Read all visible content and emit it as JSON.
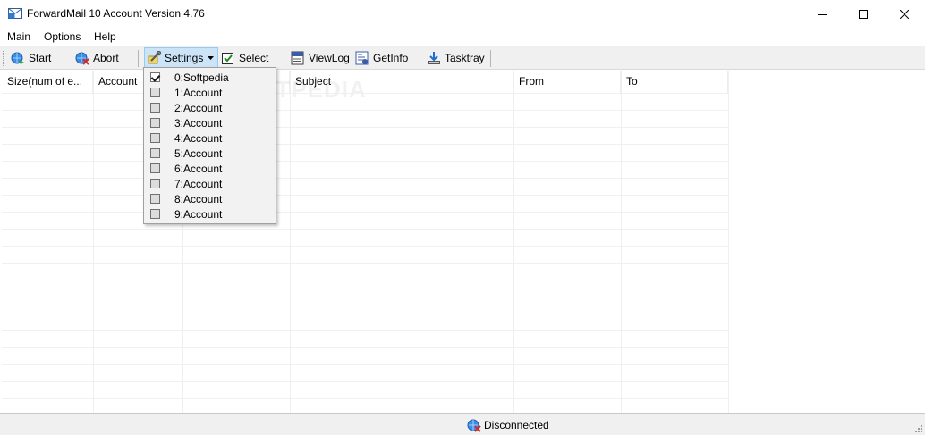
{
  "window": {
    "title": "ForwardMail 10 Account Version 4.76",
    "icon": "mail-forward-icon"
  },
  "menu": {
    "items": [
      "Main",
      "Options",
      "Help"
    ]
  },
  "toolbar": {
    "start_label": "Start",
    "abort_label": "Abort",
    "settings_label": "Settings",
    "select_label": "Select",
    "viewlog_label": "ViewLog",
    "getinfo_label": "GetInfo",
    "tasktray_label": "Tasktray"
  },
  "grid": {
    "columns": [
      "Size(num of e...",
      "Account",
      "",
      "Subject",
      "From",
      "To"
    ],
    "watermark": "SOFTPEDIA"
  },
  "settings_menu": {
    "items": [
      {
        "label": "0:Softpedia",
        "checked": true
      },
      {
        "label": "1:Account",
        "checked": false
      },
      {
        "label": "2:Account",
        "checked": false
      },
      {
        "label": "3:Account",
        "checked": false
      },
      {
        "label": "4:Account",
        "checked": false
      },
      {
        "label": "5:Account",
        "checked": false
      },
      {
        "label": "6:Account",
        "checked": false
      },
      {
        "label": "7:Account",
        "checked": false
      },
      {
        "label": "8:Account",
        "checked": false
      },
      {
        "label": "9:Account",
        "checked": false
      }
    ]
  },
  "status": {
    "text": "Disconnected"
  },
  "colors": {
    "accent": "#0078d7",
    "toolbar_bg": "#f0f0f0",
    "active_button_bg": "#cce4f7"
  }
}
